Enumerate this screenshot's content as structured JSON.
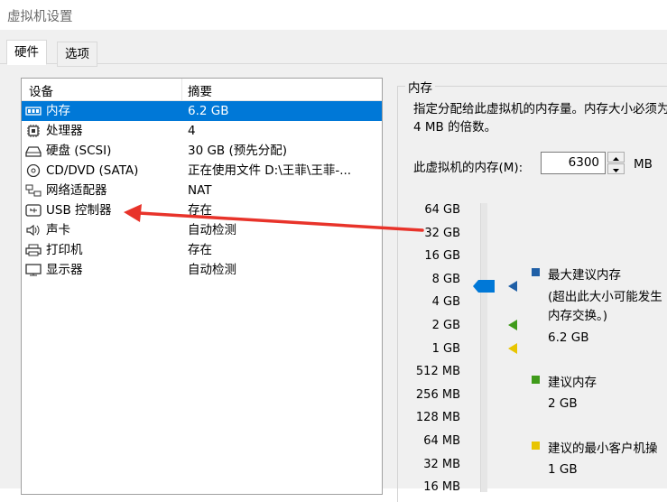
{
  "window": {
    "title": "虚拟机设置"
  },
  "tabs": [
    {
      "label": "硬件"
    },
    {
      "label": "选项"
    }
  ],
  "device_list": {
    "columns": {
      "device": "设备",
      "summary": "摘要"
    },
    "rows": [
      {
        "name": "内存",
        "summary": "6.2 GB",
        "icon": "memory-icon",
        "selected": true
      },
      {
        "name": "处理器",
        "summary": "4",
        "icon": "processor-icon"
      },
      {
        "name": "硬盘 (SCSI)",
        "summary": "30 GB (预先分配)",
        "icon": "hard-disk-icon"
      },
      {
        "name": "CD/DVD (SATA)",
        "summary": "正在使用文件 D:\\王菲\\王菲-...",
        "icon": "cd-dvd-icon"
      },
      {
        "name": "网络适配器",
        "summary": "NAT",
        "icon": "network-adapter-icon"
      },
      {
        "name": "USB 控制器",
        "summary": "存在",
        "icon": "usb-icon"
      },
      {
        "name": "声卡",
        "summary": "自动检测",
        "icon": "speaker-icon"
      },
      {
        "name": "打印机",
        "summary": "存在",
        "icon": "printer-icon"
      },
      {
        "name": "显示器",
        "summary": "自动检测",
        "icon": "monitor-icon"
      }
    ]
  },
  "memory": {
    "group_title": "内存",
    "description": "指定分配给此虚拟机的内存量。内存大小必须为 4 MB 的倍数。",
    "field_label": "此虚拟机的内存(M):",
    "value": "6300",
    "unit": "MB",
    "scale_ticks": [
      "64 GB",
      "32 GB",
      "16 GB",
      "8 GB",
      "4 GB",
      "2 GB",
      "1 GB",
      "512 MB",
      "256 MB",
      "128 MB",
      "64 MB",
      "32 MB",
      "16 MB"
    ],
    "legend": {
      "max": {
        "label": "最大建议内存",
        "note": "(超出此大小可能发生内存交换。)",
        "value": "6.2 GB",
        "color": "#1f5fa6"
      },
      "recommended": {
        "label": "建议内存",
        "value": "2 GB",
        "color": "#3f9b1a"
      },
      "guest_min": {
        "label": "建议的最小客户机操",
        "value": "1 GB",
        "color": "#e8c500"
      }
    },
    "slider_color": "#0078d7"
  },
  "annotation": {
    "arrow_color": "#e8332a"
  }
}
